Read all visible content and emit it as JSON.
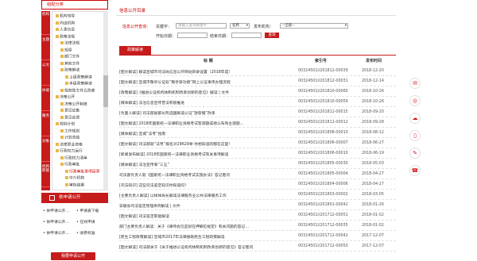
{
  "sidebar": {
    "header": "组配分类",
    "vtabs": [
      "机构",
      "主题",
      "公文",
      "体裁",
      "服务",
      "对象",
      "机构职能"
    ],
    "tree": [
      {
        "label": "机构领导",
        "indent": 0
      },
      {
        "label": "内设机构",
        "indent": 0
      },
      {
        "label": "人事信息",
        "indent": 0
      },
      {
        "label": "政策法规",
        "indent": 0
      },
      {
        "label": "法律法规",
        "indent": 1
      },
      {
        "label": "规章",
        "indent": 1
      },
      {
        "label": "部门文件",
        "indent": 1
      },
      {
        "label": "其他文件",
        "indent": 1
      },
      {
        "label": "政策解读",
        "indent": 1
      },
      {
        "label": "上级政策解读",
        "indent": 2
      },
      {
        "label": "本级政策解读",
        "indent": 2
      },
      {
        "label": "规范性文件立改废",
        "indent": 1
      },
      {
        "label": "决策公开",
        "indent": 0
      },
      {
        "label": "决策公开制度",
        "indent": 1
      },
      {
        "label": "意见征集",
        "indent": 1
      },
      {
        "label": "意见反馈",
        "indent": 1
      },
      {
        "label": "规划计划",
        "indent": 0
      },
      {
        "label": "工作规划",
        "indent": 1
      },
      {
        "label": "计划总结",
        "indent": 1
      },
      {
        "label": "法律职业资格",
        "indent": 0
      },
      {
        "label": "行政权力运行",
        "indent": 0
      },
      {
        "label": "行政权力清单",
        "indent": 1
      },
      {
        "label": "行政审批",
        "indent": 1
      },
      {
        "label": "行政审批事项目录",
        "indent": 2
      },
      {
        "label": "中介机构",
        "indent": 2
      },
      {
        "label": "审批结果",
        "indent": 2
      }
    ],
    "apply_header": "依申请公开",
    "apply_links": [
      [
        "依申请公开...",
        "申请表下载"
      ],
      [
        "依申请公开...",
        "在线申请"
      ],
      [
        "依申请公开...",
        "收费标准"
      ]
    ],
    "apply_button": "我要申请公开"
  },
  "main": {
    "title": "信息公开目录",
    "query_label": "信息公开查询：",
    "keyword_label": "关键字：",
    "keyword_placeholder": "请输入查询关键字",
    "mode_option": "名称",
    "org_label": "发布机构：",
    "org_option": "--全部--",
    "start_label": "开始日期：",
    "end_label": "结束日期：",
    "search_button": "查询",
    "tab": "政策解读",
    "col_title": "标 题",
    "col_index": "索引号",
    "col_date": "发布时间",
    "rows": [
      {
        "title": "[图文解读] 解读宣城市司法局信息公开网站目录设置（2018年度）",
        "index": "00324501l/201812-00039",
        "date": "2018-12-20"
      },
      {
        "title": "[图文解读] 宣城市敬亭公证处“敬亭渐功德”网上公证事项办理流程",
        "index": "00324501l/201812-00031",
        "date": "2018-12-14"
      },
      {
        "title": "[政策解读]《推进公证机构体制机制改革创新的意见》解读 | 文件",
        "index": "00324501l/201810-00060",
        "date": "2018-10-26"
      },
      {
        "title": "[媒体解读] 法治信息宣传普法积极推进",
        "index": "00324501l/201810-00059",
        "date": "2018-10-26"
      },
      {
        "title": "[负面人解读] 司法部副部长熊选国解读公证“放管服”改革",
        "index": "00324501l/201812-00015",
        "date": "2018-09-20"
      },
      {
        "title": "[图文解读] 2018年国家统一法律职业资格考试客观题成绩公布和主观题…",
        "index": "00324501l/201812-00012",
        "date": "2018-09-28"
      },
      {
        "title": "[媒体解读] 宣城“法考”指南",
        "index": "00324501l/201808-00010",
        "date": "2018-08-12"
      },
      {
        "title": "[图文解读] 司法部就“法考”报名对29629举 你想知道的都在这里！",
        "index": "00324501l/201806-00007",
        "date": "2018-06-27"
      },
      {
        "title": "[新闻发布解读] 2018年国家统一法律职业资格考试有关事项解读",
        "index": "00324501l/201806-00010",
        "date": "2018-06-19"
      },
      {
        "title": "[媒体解读] 法治宣传事“三五”",
        "index": "00324501l/201805-00030",
        "date": "2018-05-03"
      },
      {
        "title": "司法部负责人就《国家统一法律职业资格考试实施办法》答记者问",
        "index": "00324501l/201805-00004",
        "date": "2018-04-27"
      },
      {
        "title": "[司法知识] 这些司法鉴定知识你知道吗？",
        "index": "00324501l/201804-00006",
        "date": "2018-04-27"
      },
      {
        "title": "[主要负责人解读] 以样样局长解读法律服务业公共法律服务工作",
        "index": "00324501l/201803-00002",
        "date": "2018-03-05"
      },
      {
        "title": "安徽省司法鉴定管理条例解读 | 文件",
        "index": "00324501l/201801-00042",
        "date": "2018-01-26"
      },
      {
        "title": "[图文解读] 司法鉴定职能解读",
        "index": "00324501l/201712-00051",
        "date": "2018-01-02"
      },
      {
        "title": "部门主要负责人解读：关于《律师会见监狱在押罪犯规定》有关问题的答记…",
        "index": "00324501l/201712-00035",
        "date": "2018-01-02"
      },
      {
        "title": "[民生工程政策解读] 宣城市2017年法律援助民生工程政策解读",
        "index": "00324501l/201712-00042",
        "date": "2017-12-07"
      },
      {
        "title": "[图文解读] 司法部关于《关于推进公证机构体制机制改革创新的意见》答记者问",
        "index": "00324501l/201712-00050",
        "date": "2017-12-07"
      }
    ]
  },
  "right_icons": [
    "mail-icon",
    "weibo-icon",
    "wechat-icon",
    "mobile-icon",
    "chat-icon",
    "service-icon"
  ]
}
